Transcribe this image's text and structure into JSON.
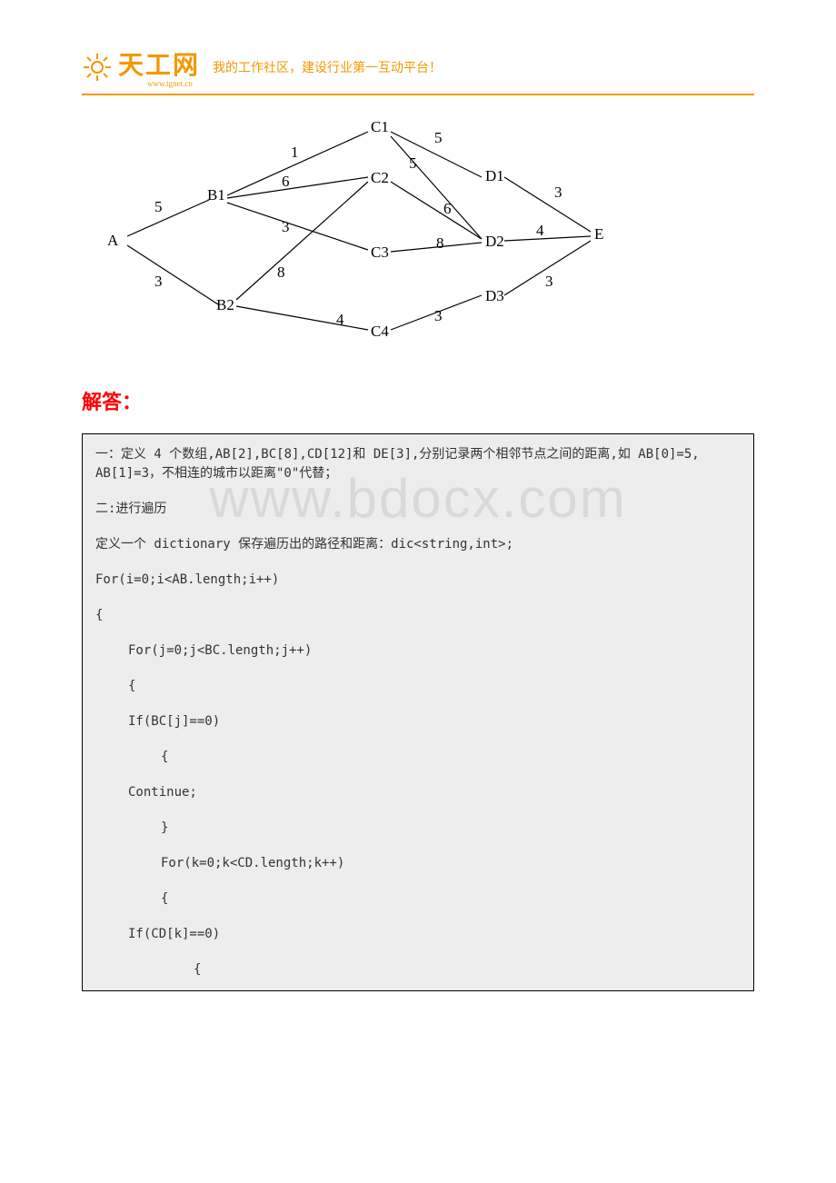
{
  "header": {
    "logo_main": "天工网",
    "logo_sub": "www.tgnet.cn",
    "tagline": "我的工作社区，建设行业第一互动平台！"
  },
  "graph": {
    "nodes": {
      "A": "A",
      "B1": "B1",
      "B2": "B2",
      "C1": "C1",
      "C2": "C2",
      "C3": "C3",
      "C4": "C4",
      "D1": "D1",
      "D2": "D2",
      "D3": "D3",
      "E": "E"
    },
    "edges": {
      "A_B1": "5",
      "A_B2": "3",
      "B1_C1": "1",
      "B1_C2": "6",
      "B1_C3": "3",
      "B2_C2": "8",
      "B2_C4": "4",
      "C1_D1": "5",
      "C1_D2": "5",
      "C2_D2": "6",
      "C3_D2": "8",
      "C4_D3": "3",
      "D1_E": "3",
      "D2_E": "4",
      "D3_E": "3"
    }
  },
  "answer_heading": "解答：",
  "code": {
    "line1": "一：定义 4 个数组,AB[2],BC[8],CD[12]和 DE[3],分别记录两个相邻节点之间的距离,如 AB[0]=5, AB[1]=3，不相连的城市以距离\"0\"代替；",
    "line2": "二:进行遍历",
    "line3": "定义一个 dictionary 保存遍历出的路径和距离：dic<string,int>;",
    "line4": "For(i=0;i<AB.length;i++)",
    "line5": "{",
    "line6": "For(j=0;j<BC.length;j++)",
    "line7": "{",
    "line8": "If(BC[j]==0)",
    "line9": "{",
    "line10": "Continue;",
    "line11": "}",
    "line12": "For(k=0;k<CD.length;k++)",
    "line13": "{",
    "line14": "If(CD[k]==0)",
    "line15": "{"
  },
  "watermark": "www.bdocx.com"
}
